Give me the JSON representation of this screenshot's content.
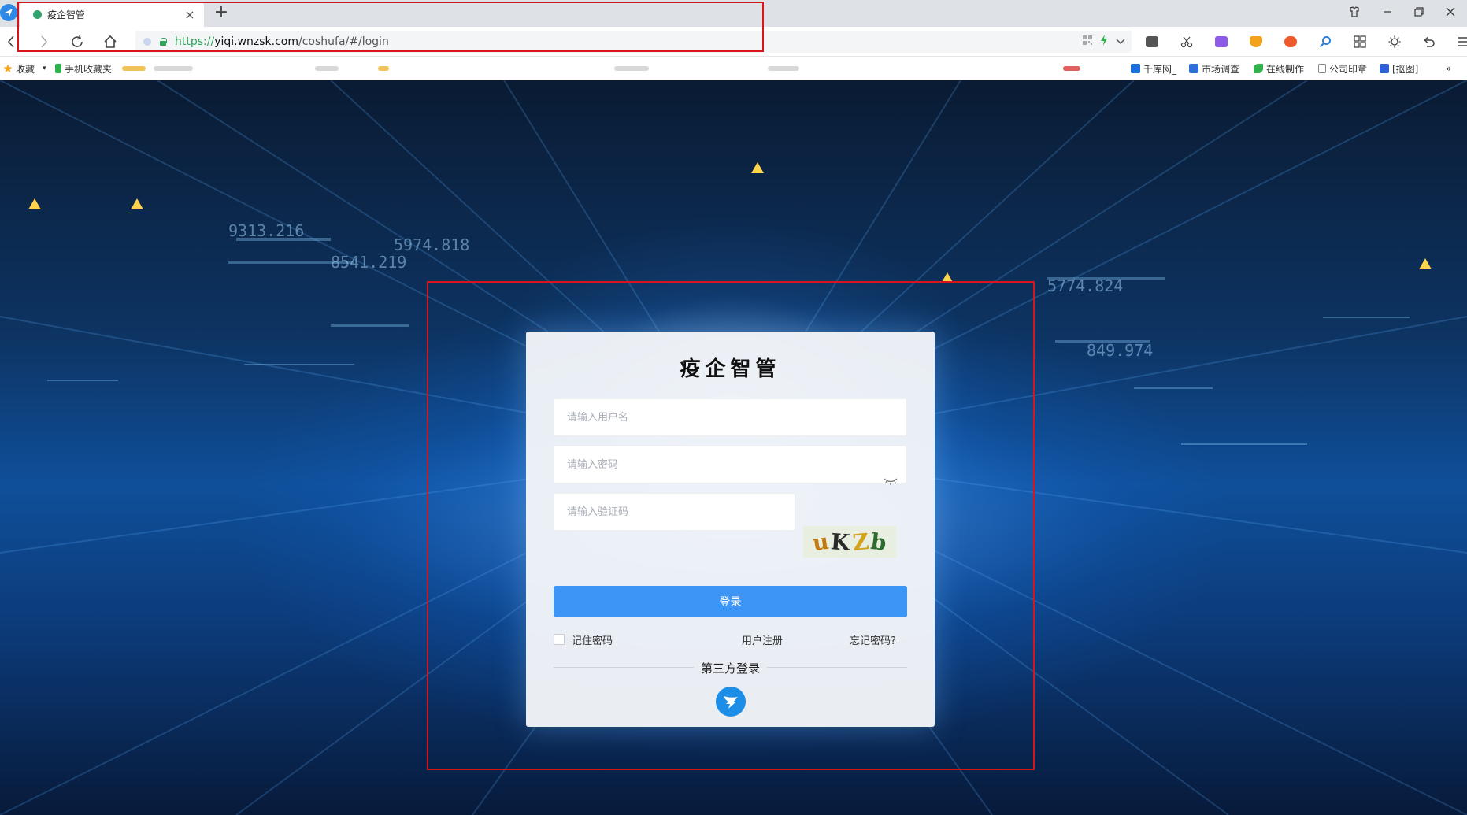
{
  "browser": {
    "tab": {
      "title": "疫企智管",
      "close_glyph": "×"
    },
    "new_tab_glyph": "+",
    "url": {
      "scheme": "https://",
      "host": "yiqi.wnzsk.com",
      "path": "/coshufa/#/login"
    },
    "window_controls": [
      "restore-down",
      "minimize",
      "maximize",
      "close"
    ]
  },
  "bookmarks": [
    {
      "label": "收藏",
      "icon": "star-icon"
    },
    {
      "label": "手机收藏夹",
      "icon": "phone-icon"
    },
    {
      "label": "千库网_",
      "icon": "k-logo-icon"
    },
    {
      "label": "市场调查",
      "icon": "chart-doc-icon"
    },
    {
      "label": "在线制作",
      "icon": "leaf-icon"
    },
    {
      "label": "公司印章",
      "icon": "doc-icon"
    },
    {
      "label": "[抠图]",
      "icon": "cutout-icon"
    }
  ],
  "bookmarks_more": "»",
  "login": {
    "title": "疫企智管",
    "username_placeholder": "请输入用户名",
    "password_placeholder": "请输入密码",
    "captcha_placeholder": "请输入验证码",
    "captcha_chars": [
      "u",
      "K",
      "Z",
      "b"
    ],
    "captcha_colors": [
      "#c47a12",
      "#2a2a2a",
      "#d4a21a",
      "#2f6d2f"
    ],
    "login_button": "登录",
    "remember_label": "记住密码",
    "register_link": "用户注册",
    "forgot_link": "忘记密码?",
    "third_party_title": "第三方登录",
    "third_party_icon": "dingtalk-icon"
  },
  "colors": {
    "primary": "#3d96f6",
    "highlight_frame": "#d9141b",
    "dingtalk": "#1d8ee8"
  }
}
